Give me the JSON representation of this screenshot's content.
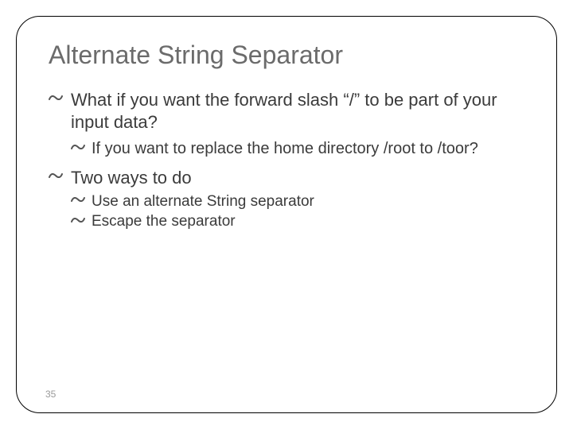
{
  "title": "Alternate String Separator",
  "bullets": {
    "b1": "What if you want the forward slash “/” to be part of your input data?",
    "b1_1": "If you want to replace the home directory /root to /toor?",
    "b2": "Two ways to do",
    "b2_1": "Use an alternate String separator",
    "b2_2": "Escape the separator"
  },
  "pageNumber": "35"
}
